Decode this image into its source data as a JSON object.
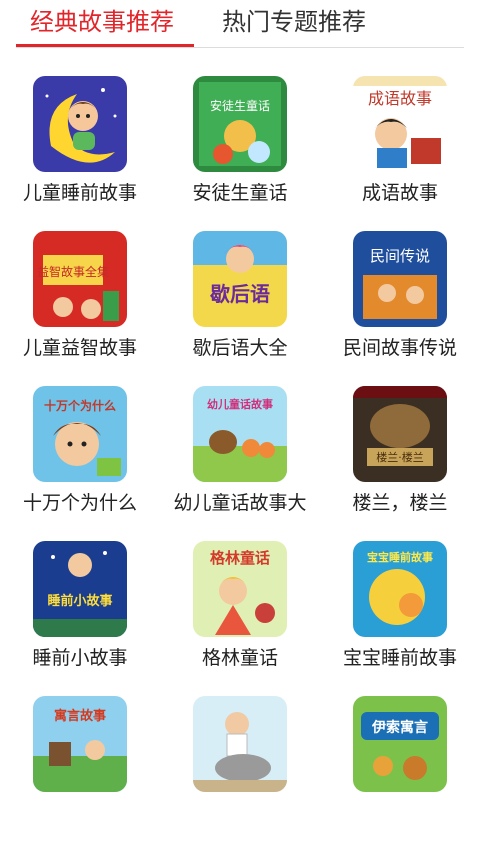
{
  "tabs": [
    {
      "label": "经典故事推荐",
      "active": true
    },
    {
      "label": "热门专题推荐",
      "active": false
    }
  ],
  "colors": {
    "accent": "#e0262b",
    "text": "#222222",
    "inactive_tab": "#333333"
  },
  "stories": [
    {
      "title": "儿童睡前故事",
      "cover_text": ""
    },
    {
      "title": "安徒生童话",
      "cover_text": "安徒生童话"
    },
    {
      "title": "成语故事",
      "cover_text": "成语故事"
    },
    {
      "title": "儿童益智故事",
      "cover_text": "益智故事全集"
    },
    {
      "title": "歇后语大全",
      "cover_text": "歇后语"
    },
    {
      "title": "民间故事传说",
      "cover_text": "民间传说"
    },
    {
      "title": "十万个为什么",
      "cover_text": "十万个为什么"
    },
    {
      "title": "幼儿童话故事大",
      "cover_text": "幼儿童话故事"
    },
    {
      "title": "楼兰，楼兰",
      "cover_text": "楼兰·楼兰"
    },
    {
      "title": "睡前小故事",
      "cover_text": "睡前小故事"
    },
    {
      "title": "格林童话",
      "cover_text": "格林童话"
    },
    {
      "title": "宝宝睡前故事",
      "cover_text": "宝宝睡前故事"
    },
    {
      "title": "",
      "cover_text": "寓言故事"
    },
    {
      "title": "",
      "cover_text": ""
    },
    {
      "title": "",
      "cover_text": "伊索寓言"
    }
  ]
}
